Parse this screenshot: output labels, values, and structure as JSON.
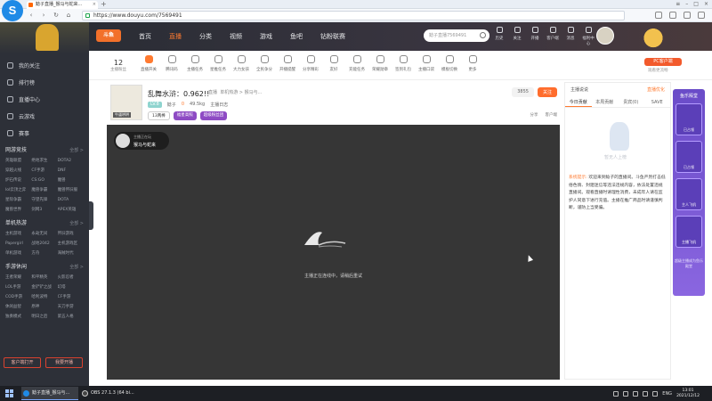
{
  "browser": {
    "app_icon": "S",
    "tab_title": "鲶子直播_猴马与蛇来...",
    "tab_add": "+",
    "url": "https://www.douyu.com/7569491"
  },
  "topnav": {
    "logo_label": "斗鱼",
    "links": [
      "首页",
      "直播",
      "分类",
      "视频",
      "游戏",
      "鱼吧",
      "钻粉联赛"
    ],
    "search_placeholder": "鲶子直播7569491",
    "tools": [
      "历史",
      "关注",
      "开播",
      "客户端",
      "消息",
      "福利中心"
    ]
  },
  "categories": {
    "follow_count": "12",
    "follow_label": "主播粉丝",
    "items": [
      "直播开关",
      "腾讯码",
      "主播任务",
      "星推任务",
      "大力女孩",
      "全民争分",
      "开播提醒",
      "分享精彩",
      "友好",
      "充能任务",
      "荣耀勋章",
      "签到礼包",
      "主播口袋",
      "模板切换",
      "更多"
    ],
    "pc_badge": "PC客户端",
    "pc_sub": "观看更流畅"
  },
  "sidebar": {
    "nav": [
      "我的关注",
      "排行榜",
      "直播中心",
      "云游戏",
      "赛事"
    ],
    "groups": [
      {
        "title": "网游竞技",
        "more": "全部 >",
        "items": [
          "英雄联盟",
          "绝地求生",
          "DOTA2",
          "穿越火线",
          "CF手游",
          "DNF",
          "炉石传说",
          "CS:GO",
          "魔兽",
          "lol云顶之弈",
          "魔兽争霸",
          "魔兽怀旧服",
          "星际争霸",
          "守望先锋",
          "DOTA",
          "魔兽世界",
          "剑网3",
          "APEX英雄"
        ]
      },
      {
        "title": "单机热游",
        "more": "全部 >",
        "items": [
          "主机游戏",
          "永劫无间",
          "怀旧游戏",
          "Papergirl",
          "战地2042",
          "主机游戏区",
          "单机游戏",
          "方舟",
          "海贼时代"
        ]
      },
      {
        "title": "手游休闲",
        "more": "全部 >",
        "items": [
          "王者荣耀",
          "和平精英",
          "火影忍者",
          "LOL手游",
          "金铲铲之战",
          "幻塔",
          "COD手游",
          "哈利波特",
          "CF手游",
          "休闲益智",
          "原神",
          "天刀手游",
          "独奏模式",
          "明日之后",
          "第五人格"
        ]
      }
    ],
    "bottom_buttons": [
      "客户端打开",
      "我要开播"
    ]
  },
  "room": {
    "title": "乱舞水浒：0.962!!",
    "category_label": "直播",
    "category_path": "单机热游 > 猴马与...",
    "level_badge": "LV.8",
    "anchor_name": "鲶子",
    "hot_value": "0",
    "followers": "49.5kg",
    "report": "主播日志",
    "tags": [
      "13两棒",
      "福星高照",
      "超级粉丝团"
    ],
    "follow_count": "3855",
    "follow_button": "关注",
    "actions": [
      "分享",
      "客户端"
    ],
    "avatar_label": "牛逼哄哄"
  },
  "player": {
    "chip_line1": "主播正在玩",
    "chip_line2": "猴马与蛇来",
    "message": "主播正在连线中，请稍后重试"
  },
  "rightpanel": {
    "rank_label": "主播说说",
    "rank_accent": "直播优化",
    "tabs": [
      "今日贡献",
      "本周贡献",
      "贵宾(0)",
      "SAVE"
    ],
    "empty_text": "暂无人上榜",
    "notice_label": "系统提示:",
    "notice_text": "欢迎来到鲶子的直播间。斗鱼严厉打击低俗色情、封建迷信等违法违规内容，依法处置违规直播间。观看直播时请理性消费，未成年人请在监护人同意下进行充值。主播在推广商品时请谨慎判断，谨防上当受骗。"
  },
  "promo": {
    "title": "鱼乐殿堂",
    "cards": [
      "已占领",
      "已占领",
      "主人飞机",
      "主播飞机"
    ],
    "footer": "超级主播成为鱼乐殿堂"
  },
  "taskbar": {
    "tasks": [
      "鲶子直播_猴马与...",
      "OBS 27.1.3 (64 bi..."
    ],
    "lang": "ENG",
    "time": "13:01",
    "date": "2021/12/12"
  }
}
